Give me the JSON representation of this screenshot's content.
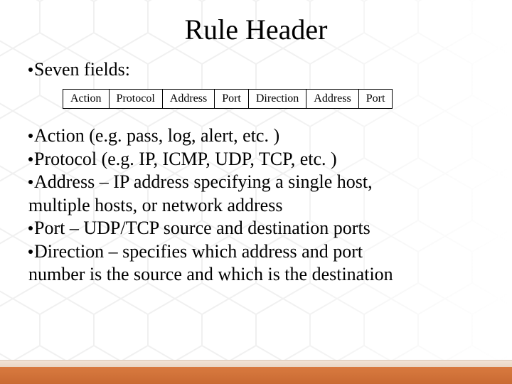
{
  "title": "Rule Header",
  "intro": "Seven fields:",
  "columns": [
    "Action",
    "Protocol",
    "Address",
    "Port",
    "Direction",
    "Address",
    "Port"
  ],
  "bullets": {
    "action": "Action (e.g. pass, log, alert, etc. )",
    "protocol": "Protocol (e.g. IP, ICMP, UDP, TCP, etc. )",
    "address_l1": "Address – IP address specifying a single host,",
    "address_l2": "multiple hosts, or network address",
    "port": "Port – UDP/TCP source and destination ports",
    "direction_l1": "Direction – specifies which address and port",
    "direction_l2": "number is the source and which is the destination"
  }
}
